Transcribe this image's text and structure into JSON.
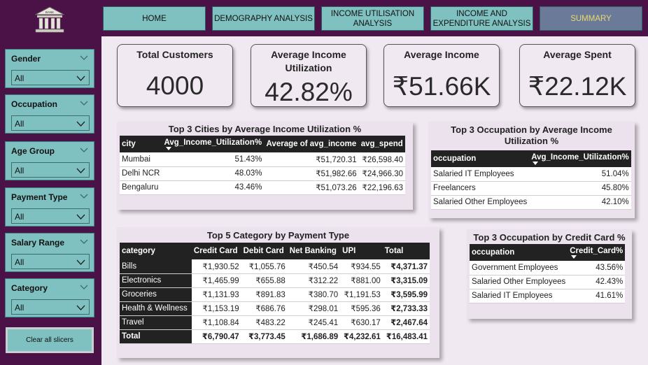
{
  "nav": {
    "home": "HOME",
    "demography": "DEMOGRAPHY ANALYSIS",
    "income_util": "INCOME UTILISATION ANALYSIS",
    "income_exp": "INCOME AND EXPENDITURE ANALYSIS",
    "summary": "SUMMARY"
  },
  "logo": {
    "text": "BANK"
  },
  "slicers": [
    {
      "title": "Gender",
      "value": "All"
    },
    {
      "title": "Occupation",
      "value": "All"
    },
    {
      "title": "Age Group",
      "value": "All"
    },
    {
      "title": "Payment Type",
      "value": "All"
    },
    {
      "title": "Salary Range",
      "value": "All"
    },
    {
      "title": "Category",
      "value": "All"
    }
  ],
  "clear_button": "Clear all slicers",
  "kpis": {
    "total_customers": {
      "title": "Total Customers",
      "value": "4000"
    },
    "avg_util": {
      "title_1": "Average Income",
      "title_2": "Utilization",
      "value": "42.82%"
    },
    "avg_income": {
      "title": "Average Income",
      "value": "₹51.66K"
    },
    "avg_spent": {
      "title": "Average Spent",
      "value": "₹22.12K"
    }
  },
  "cities": {
    "title": "Top 3 Cities by Average Income Utilization %",
    "headers": [
      "city",
      "Avg_Income_Utilization%",
      "Average of avg_income",
      "avg_spend"
    ],
    "rows": [
      [
        "Mumbai",
        "51.43%",
        "₹51,720.31",
        "₹26,598.40"
      ],
      [
        "Delhi NCR",
        "48.03%",
        "₹51,982.66",
        "₹24,966.30"
      ],
      [
        "Bengaluru",
        "43.46%",
        "₹51,073.26",
        "₹22,196.63"
      ]
    ]
  },
  "occ_util": {
    "title_1": "Top 3 Occupation by Average Income",
    "title_2": "Utilization %",
    "headers": [
      "occupation",
      "Avg_Income_Utilization%"
    ],
    "rows": [
      [
        "Salaried IT Employees",
        "51.04%"
      ],
      [
        "Freelancers",
        "45.80%"
      ],
      [
        "Salaried Other Employees",
        "42.10%"
      ]
    ]
  },
  "category": {
    "title": "Top 5 Category by Payment Type",
    "headers": [
      "category",
      "Credit Card",
      "Debit Card",
      "Net Banking",
      "UPI",
      "Total"
    ],
    "rows": [
      [
        "Bills",
        "₹1,930.52",
        "₹1,055.76",
        "₹450.54",
        "₹934.55",
        "₹4,371.37"
      ],
      [
        "Electronics",
        "₹1,465.99",
        "₹655.88",
        "₹312.22",
        "₹881.00",
        "₹3,315.09"
      ],
      [
        "Groceries",
        "₹1,131.93",
        "₹891.83",
        "₹380.70",
        "₹1,191.53",
        "₹3,595.99"
      ],
      [
        "Health & Wellness",
        "₹1,153.19",
        "₹686.76",
        "₹298.01",
        "₹595.36",
        "₹2,733.33"
      ],
      [
        "Travel",
        "₹1,108.84",
        "₹483.22",
        "₹245.41",
        "₹630.17",
        "₹2,467.64"
      ]
    ],
    "total": [
      "Total",
      "₹6,790.47",
      "₹3,773.45",
      "₹1,686.89",
      "₹4,232.61",
      "₹16,483.41"
    ]
  },
  "occ_credit": {
    "title": "Top 3 Occupation by Credit Card %",
    "headers": [
      "occupation",
      "Credit_Card%"
    ],
    "rows": [
      [
        "Government Employees",
        "43.56%"
      ],
      [
        "Salaried Other Employees",
        "42.43%"
      ],
      [
        "Salaried IT Employees",
        "41.61%"
      ]
    ]
  },
  "colors": {
    "background": "#4a1246",
    "accent": "#7fc0c0",
    "canvas": "#f1e9f2",
    "active_nav": "#6c7a9a",
    "active_nav_text": "#e8d96b"
  }
}
